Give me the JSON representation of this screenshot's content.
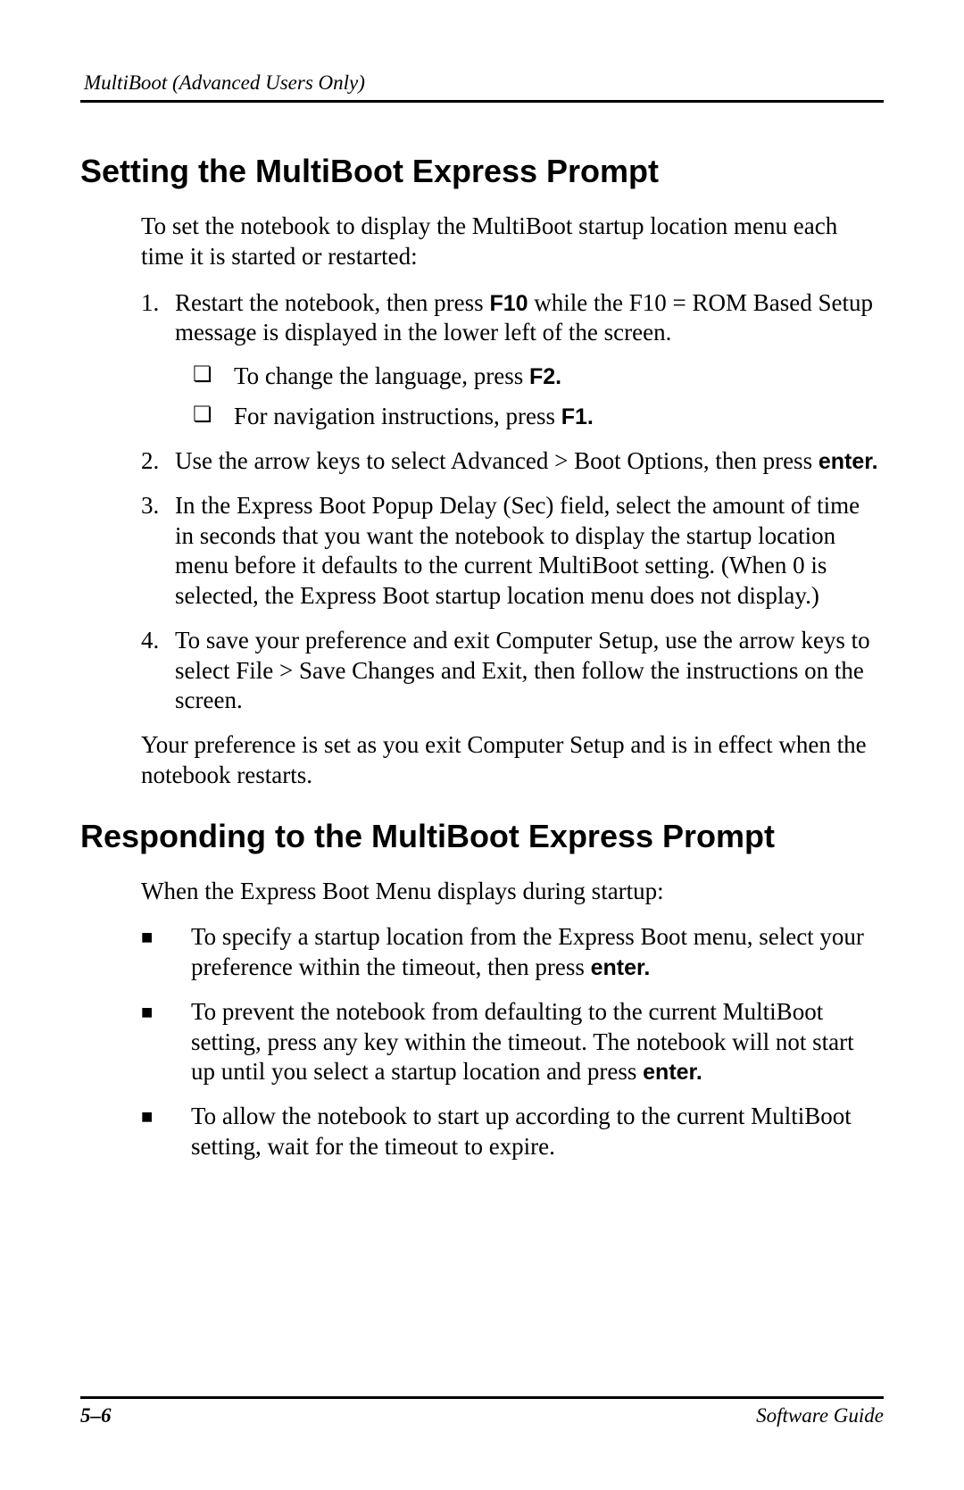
{
  "header": {
    "running": "MultiBoot (Advanced Users Only)"
  },
  "section1": {
    "title": "Setting the MultiBoot Express Prompt",
    "intro": "To set the notebook to display the MultiBoot startup location menu each time it is started or restarted:",
    "steps": [
      {
        "num": "1.",
        "text_a": "Restart the notebook, then press ",
        "key_a": "F10",
        "text_b": " while the F10 = ROM Based Setup message is displayed in the lower left of the screen.",
        "sub": [
          {
            "text_a": "To change the language, press ",
            "key": "F2."
          },
          {
            "text_a": "For navigation instructions, press ",
            "key": "F1."
          }
        ]
      },
      {
        "num": "2.",
        "text_a": "Use the arrow keys to select Advanced > Boot Options, then press ",
        "key_a": "enter.",
        "text_b": ""
      },
      {
        "num": "3.",
        "text_a": "In the Express Boot Popup Delay (Sec) field, select the amount of time in seconds that you want the notebook to display the startup location menu before it defaults to the current MultiBoot setting. (When 0 is selected, the Express Boot startup location menu does not display.)",
        "key_a": "",
        "text_b": ""
      },
      {
        "num": "4.",
        "text_a": "To save your preference and exit Computer Setup, use the arrow keys to select File > Save Changes and Exit, then follow the instructions on the screen.",
        "key_a": "",
        "text_b": ""
      }
    ],
    "closing": "Your preference is set as you exit Computer Setup and is in effect when the notebook restarts."
  },
  "section2": {
    "title": "Responding to the MultiBoot Express Prompt",
    "intro": "When the Express Boot Menu displays during startup:",
    "bullets": [
      {
        "text_a": "To specify a startup location from the Express Boot menu, select your preference within the timeout, then press ",
        "key": "enter.",
        "text_b": ""
      },
      {
        "text_a": "To prevent the notebook from defaulting to the current MultiBoot setting, press any key within the timeout. The notebook will not start up until you select a startup location and press ",
        "key": "enter.",
        "text_b": ""
      },
      {
        "text_a": "To allow the notebook to start up according to the current MultiBoot setting, wait for the timeout to expire.",
        "key": "",
        "text_b": ""
      }
    ]
  },
  "footer": {
    "page": "5–6",
    "guide": "Software Guide"
  }
}
